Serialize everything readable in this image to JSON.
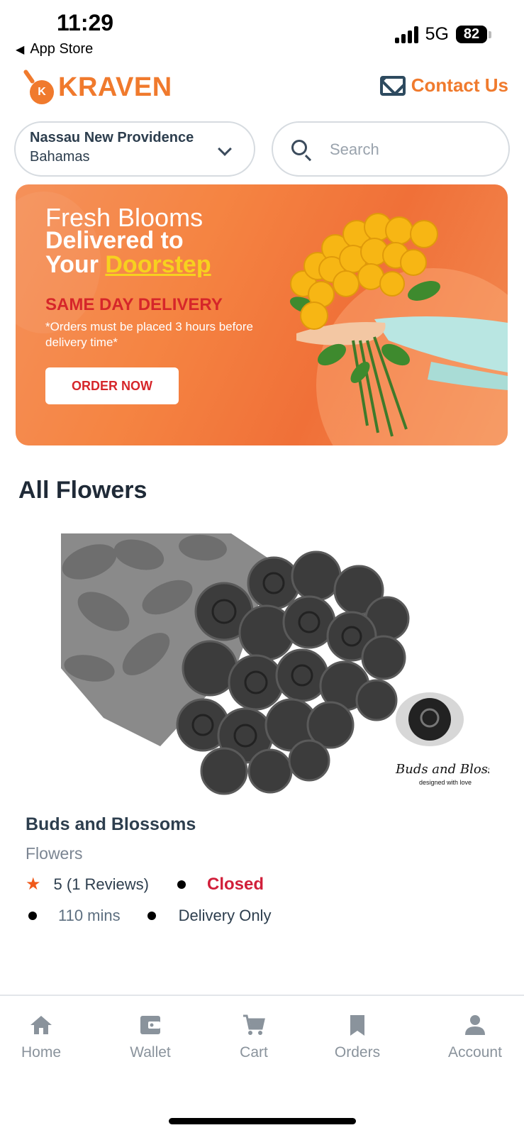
{
  "status_bar": {
    "time": "11:29",
    "back_label": "App Store",
    "network": "5G",
    "battery": "82"
  },
  "header": {
    "brand": "KRAVEN",
    "logo_letter": "K",
    "contact_label": "Contact Us"
  },
  "location": {
    "line1": "Nassau New Providence",
    "line2": "Bahamas"
  },
  "search": {
    "placeholder": "Search"
  },
  "banner": {
    "line1": "Fresh Blooms",
    "line2": "Delivered to",
    "line3_prefix": "Your ",
    "line3_highlight": "Doorstep",
    "same_day": "SAME DAY DELIVERY",
    "note": "*Orders must be placed 3 hours before delivery time*",
    "cta": "ORDER NOW"
  },
  "section": {
    "title": "All Flowers"
  },
  "product": {
    "watermark": "Buds and Blossoms",
    "watermark_sub": "designed with love",
    "name": "Buds and Blossoms",
    "category": "Flowers",
    "rating": "5 (1 Reviews)",
    "status": "Closed",
    "time": "110 mins",
    "delivery": "Delivery Only"
  },
  "nav": {
    "items": [
      {
        "label": "Home",
        "icon": "home-icon"
      },
      {
        "label": "Wallet",
        "icon": "wallet-icon"
      },
      {
        "label": "Cart",
        "icon": "cart-icon"
      },
      {
        "label": "Orders",
        "icon": "bookmark-icon"
      },
      {
        "label": "Account",
        "icon": "account-icon"
      }
    ]
  },
  "colors": {
    "brand": "#f07a2d",
    "closed": "#d11f3a",
    "star": "#f05a1a",
    "nav_inactive": "#8a939c"
  }
}
